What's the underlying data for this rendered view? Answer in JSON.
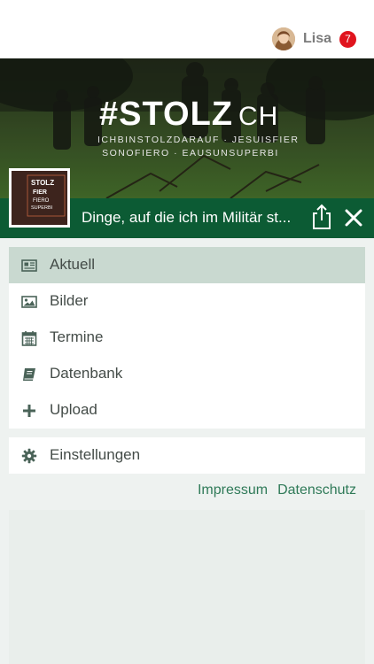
{
  "user": {
    "name": "Lisa",
    "notifications": "7"
  },
  "hero": {
    "title": "#STOLZ",
    "title_suffix": "CH",
    "subtitle_line1": "ICHBINSTOLZDARAUF · JESUISFIER",
    "subtitle_line2": "SONOFIERO · EAUSUNSUPERBI"
  },
  "article": {
    "title": "Dinge, auf die ich im Militär st..."
  },
  "thumb": {
    "line1": "STOLZ",
    "line2": "FIER",
    "line3": "FIERO",
    "line4": "SUPERBI"
  },
  "menu": {
    "items": [
      {
        "label": "Aktuell",
        "icon": "newspaper-icon"
      },
      {
        "label": "Bilder",
        "icon": "image-icon"
      },
      {
        "label": "Termine",
        "icon": "calendar-icon"
      },
      {
        "label": "Datenbank",
        "icon": "book-icon"
      },
      {
        "label": "Upload",
        "icon": "plus-icon"
      }
    ],
    "settings": {
      "label": "Einstellungen",
      "icon": "gear-icon"
    }
  },
  "footer": {
    "impressum": "Impressum",
    "datenschutz": "Datenschutz"
  },
  "colors": {
    "accent_green": "#0c5b34",
    "active_item": "#c9d9d0",
    "link_green": "#2f7a58",
    "badge_red": "#e0141e"
  }
}
